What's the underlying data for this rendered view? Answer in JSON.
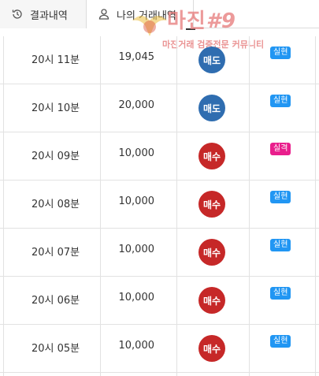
{
  "tabs": [
    {
      "label": "결과내역",
      "icon": "history-icon"
    },
    {
      "label": "나의 거래내역",
      "icon": "user-icon"
    }
  ],
  "watermark": {
    "title": "마진",
    "title_suffix": "#9",
    "subtitle": "마진거래 검증전문 커뮤니티"
  },
  "colors": {
    "sell": "#2f6db0",
    "buy": "#c62828",
    "success": "#2196f3",
    "fail": "#e91e8c"
  },
  "rows": [
    {
      "time": "20시 11분",
      "amount": "19,045",
      "side": "매도",
      "side_color": "#2f6db0",
      "result": "실현",
      "result_color": "#2196f3"
    },
    {
      "time": "20시 10분",
      "amount": "20,000",
      "side": "매도",
      "side_color": "#2f6db0",
      "result": "실현",
      "result_color": "#2196f3"
    },
    {
      "time": "20시 09분",
      "amount": "10,000",
      "side": "매수",
      "side_color": "#c62828",
      "result": "실격",
      "result_color": "#e91e8c"
    },
    {
      "time": "20시 08분",
      "amount": "10,000",
      "side": "매수",
      "side_color": "#c62828",
      "result": "실현",
      "result_color": "#2196f3"
    },
    {
      "time": "20시 07분",
      "amount": "10,000",
      "side": "매수",
      "side_color": "#c62828",
      "result": "실현",
      "result_color": "#2196f3"
    },
    {
      "time": "20시 06분",
      "amount": "10,000",
      "side": "매수",
      "side_color": "#c62828",
      "result": "실현",
      "result_color": "#2196f3"
    },
    {
      "time": "20시 05분",
      "amount": "10,000",
      "side": "매수",
      "side_color": "#c62828",
      "result": "실현",
      "result_color": "#2196f3"
    }
  ]
}
